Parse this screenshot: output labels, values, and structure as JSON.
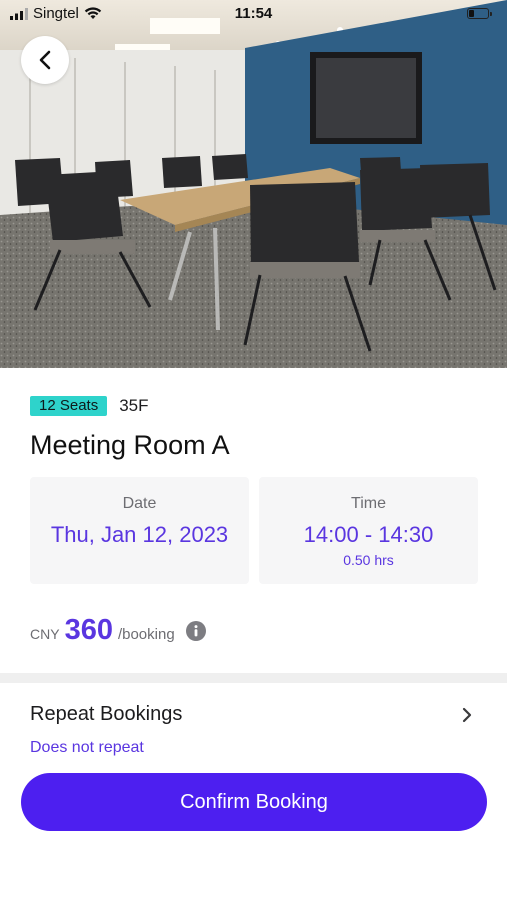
{
  "status_bar": {
    "carrier": "Singtel",
    "time": "11:54",
    "icons": [
      "signal-icon",
      "wifi-icon",
      "battery-icon"
    ]
  },
  "header": {
    "back_icon": "chevron-left-icon"
  },
  "room": {
    "seats_badge": "12 Seats",
    "floor": "35F",
    "name": "Meeting Room A"
  },
  "booking": {
    "date_label": "Date",
    "date_value": "Thu, Jan 12, 2023",
    "time_label": "Time",
    "time_value": "14:00 - 14:30",
    "duration": "0.50 hrs"
  },
  "price": {
    "currency": "CNY",
    "amount": "360",
    "unit": "/booking",
    "info_icon": "info-icon"
  },
  "repeat": {
    "label": "Repeat Bookings",
    "value": "Does not repeat",
    "chevron_icon": "chevron-right-icon"
  },
  "actions": {
    "confirm_label": "Confirm Booking"
  },
  "colors": {
    "accent": "#5a36e0",
    "button": "#4d1ff0",
    "badge": "#2ed3cb",
    "card_bg": "#f6f6f7"
  }
}
